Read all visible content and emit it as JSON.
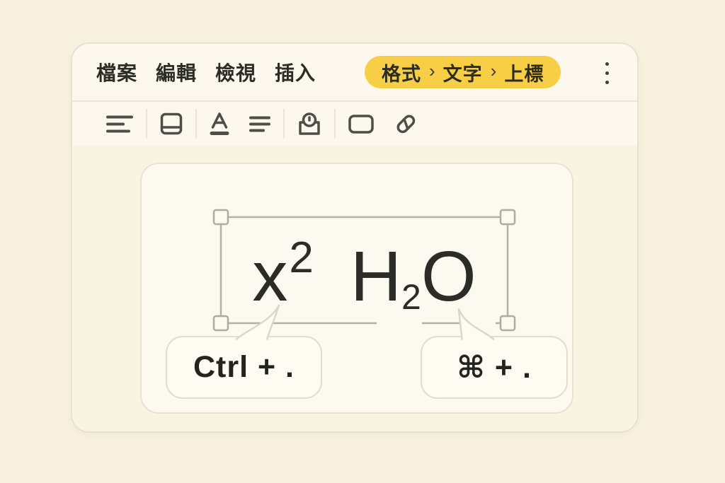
{
  "menu": {
    "items": [
      "檔案",
      "編輯",
      "檢視",
      "插入"
    ]
  },
  "breadcrumb": {
    "parts": [
      "格式",
      "文字",
      "上標"
    ],
    "separator": "›"
  },
  "toolbar": {
    "icons": [
      "format-lines-icon",
      "page-section-icon",
      "text-color-icon",
      "align-left-icon",
      "voice-input-icon",
      "shape-icon",
      "link-icon"
    ]
  },
  "canvas": {
    "formula": {
      "base": "x",
      "superscript": "2",
      "h": "H",
      "subscript": "2",
      "o": "O"
    },
    "shortcuts": {
      "windows": "Ctrl + .",
      "mac": "⌘ + ."
    }
  },
  "colors": {
    "page_background": "#f7f0de",
    "window_background": "#fcf8ed",
    "window_border": "#e8e1d0",
    "accent_yellow": "#f8ce47",
    "text_dark": "#2b2c26",
    "icon_gray": "#4e4e48",
    "panel_background": "#fcf9f0",
    "selection_gray": "#b3b0a4",
    "bubble_border": "#e3ddcc"
  }
}
